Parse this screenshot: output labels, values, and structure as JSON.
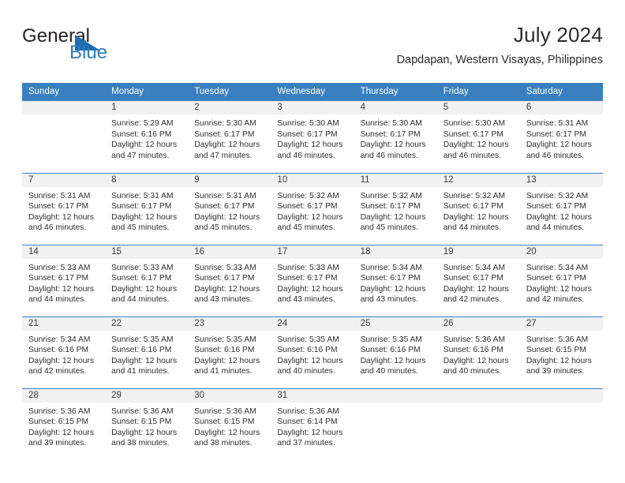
{
  "brand": {
    "word1": "General",
    "word2": "Blue",
    "logo_color": "#2b7cc3"
  },
  "header": {
    "title": "July 2024",
    "subtitle": "Dapdapan, Western Visayas, Philippines"
  },
  "theme": {
    "header_blue": "#3a7fbf",
    "daynum_band": "#f1f1f1"
  },
  "weekday_headers": [
    "Sunday",
    "Monday",
    "Tuesday",
    "Wednesday",
    "Thursday",
    "Friday",
    "Saturday"
  ],
  "weeks": [
    [
      {
        "day": "",
        "blank": true,
        "sunrise": "",
        "sunset": "",
        "daylight1": "",
        "daylight2": ""
      },
      {
        "day": "1",
        "sunrise": "Sunrise: 5:29 AM",
        "sunset": "Sunset: 6:16 PM",
        "daylight1": "Daylight: 12 hours",
        "daylight2": "and 47 minutes."
      },
      {
        "day": "2",
        "sunrise": "Sunrise: 5:30 AM",
        "sunset": "Sunset: 6:17 PM",
        "daylight1": "Daylight: 12 hours",
        "daylight2": "and 47 minutes."
      },
      {
        "day": "3",
        "sunrise": "Sunrise: 5:30 AM",
        "sunset": "Sunset: 6:17 PM",
        "daylight1": "Daylight: 12 hours",
        "daylight2": "and 46 minutes."
      },
      {
        "day": "4",
        "sunrise": "Sunrise: 5:30 AM",
        "sunset": "Sunset: 6:17 PM",
        "daylight1": "Daylight: 12 hours",
        "daylight2": "and 46 minutes."
      },
      {
        "day": "5",
        "sunrise": "Sunrise: 5:30 AM",
        "sunset": "Sunset: 6:17 PM",
        "daylight1": "Daylight: 12 hours",
        "daylight2": "and 46 minutes."
      },
      {
        "day": "6",
        "sunrise": "Sunrise: 5:31 AM",
        "sunset": "Sunset: 6:17 PM",
        "daylight1": "Daylight: 12 hours",
        "daylight2": "and 46 minutes."
      }
    ],
    [
      {
        "day": "7",
        "sunrise": "Sunrise: 5:31 AM",
        "sunset": "Sunset: 6:17 PM",
        "daylight1": "Daylight: 12 hours",
        "daylight2": "and 46 minutes."
      },
      {
        "day": "8",
        "sunrise": "Sunrise: 5:31 AM",
        "sunset": "Sunset: 6:17 PM",
        "daylight1": "Daylight: 12 hours",
        "daylight2": "and 45 minutes."
      },
      {
        "day": "9",
        "sunrise": "Sunrise: 5:31 AM",
        "sunset": "Sunset: 6:17 PM",
        "daylight1": "Daylight: 12 hours",
        "daylight2": "and 45 minutes."
      },
      {
        "day": "10",
        "sunrise": "Sunrise: 5:32 AM",
        "sunset": "Sunset: 6:17 PM",
        "daylight1": "Daylight: 12 hours",
        "daylight2": "and 45 minutes."
      },
      {
        "day": "11",
        "sunrise": "Sunrise: 5:32 AM",
        "sunset": "Sunset: 6:17 PM",
        "daylight1": "Daylight: 12 hours",
        "daylight2": "and 45 minutes."
      },
      {
        "day": "12",
        "sunrise": "Sunrise: 5:32 AM",
        "sunset": "Sunset: 6:17 PM",
        "daylight1": "Daylight: 12 hours",
        "daylight2": "and 44 minutes."
      },
      {
        "day": "13",
        "sunrise": "Sunrise: 5:32 AM",
        "sunset": "Sunset: 6:17 PM",
        "daylight1": "Daylight: 12 hours",
        "daylight2": "and 44 minutes."
      }
    ],
    [
      {
        "day": "14",
        "sunrise": "Sunrise: 5:33 AM",
        "sunset": "Sunset: 6:17 PM",
        "daylight1": "Daylight: 12 hours",
        "daylight2": "and 44 minutes."
      },
      {
        "day": "15",
        "sunrise": "Sunrise: 5:33 AM",
        "sunset": "Sunset: 6:17 PM",
        "daylight1": "Daylight: 12 hours",
        "daylight2": "and 44 minutes."
      },
      {
        "day": "16",
        "sunrise": "Sunrise: 5:33 AM",
        "sunset": "Sunset: 6:17 PM",
        "daylight1": "Daylight: 12 hours",
        "daylight2": "and 43 minutes."
      },
      {
        "day": "17",
        "sunrise": "Sunrise: 5:33 AM",
        "sunset": "Sunset: 6:17 PM",
        "daylight1": "Daylight: 12 hours",
        "daylight2": "and 43 minutes."
      },
      {
        "day": "18",
        "sunrise": "Sunrise: 5:34 AM",
        "sunset": "Sunset: 6:17 PM",
        "daylight1": "Daylight: 12 hours",
        "daylight2": "and 43 minutes."
      },
      {
        "day": "19",
        "sunrise": "Sunrise: 5:34 AM",
        "sunset": "Sunset: 6:17 PM",
        "daylight1": "Daylight: 12 hours",
        "daylight2": "and 42 minutes."
      },
      {
        "day": "20",
        "sunrise": "Sunrise: 5:34 AM",
        "sunset": "Sunset: 6:17 PM",
        "daylight1": "Daylight: 12 hours",
        "daylight2": "and 42 minutes."
      }
    ],
    [
      {
        "day": "21",
        "sunrise": "Sunrise: 5:34 AM",
        "sunset": "Sunset: 6:16 PM",
        "daylight1": "Daylight: 12 hours",
        "daylight2": "and 42 minutes."
      },
      {
        "day": "22",
        "sunrise": "Sunrise: 5:35 AM",
        "sunset": "Sunset: 6:16 PM",
        "daylight1": "Daylight: 12 hours",
        "daylight2": "and 41 minutes."
      },
      {
        "day": "23",
        "sunrise": "Sunrise: 5:35 AM",
        "sunset": "Sunset: 6:16 PM",
        "daylight1": "Daylight: 12 hours",
        "daylight2": "and 41 minutes."
      },
      {
        "day": "24",
        "sunrise": "Sunrise: 5:35 AM",
        "sunset": "Sunset: 6:16 PM",
        "daylight1": "Daylight: 12 hours",
        "daylight2": "and 40 minutes."
      },
      {
        "day": "25",
        "sunrise": "Sunrise: 5:35 AM",
        "sunset": "Sunset: 6:16 PM",
        "daylight1": "Daylight: 12 hours",
        "daylight2": "and 40 minutes."
      },
      {
        "day": "26",
        "sunrise": "Sunrise: 5:36 AM",
        "sunset": "Sunset: 6:16 PM",
        "daylight1": "Daylight: 12 hours",
        "daylight2": "and 40 minutes."
      },
      {
        "day": "27",
        "sunrise": "Sunrise: 5:36 AM",
        "sunset": "Sunset: 6:15 PM",
        "daylight1": "Daylight: 12 hours",
        "daylight2": "and 39 minutes."
      }
    ],
    [
      {
        "day": "28",
        "sunrise": "Sunrise: 5:36 AM",
        "sunset": "Sunset: 6:15 PM",
        "daylight1": "Daylight: 12 hours",
        "daylight2": "and 39 minutes."
      },
      {
        "day": "29",
        "sunrise": "Sunrise: 5:36 AM",
        "sunset": "Sunset: 6:15 PM",
        "daylight1": "Daylight: 12 hours",
        "daylight2": "and 38 minutes."
      },
      {
        "day": "30",
        "sunrise": "Sunrise: 5:36 AM",
        "sunset": "Sunset: 6:15 PM",
        "daylight1": "Daylight: 12 hours",
        "daylight2": "and 38 minutes."
      },
      {
        "day": "31",
        "sunrise": "Sunrise: 5:36 AM",
        "sunset": "Sunset: 6:14 PM",
        "daylight1": "Daylight: 12 hours",
        "daylight2": "and 37 minutes."
      },
      {
        "day": "",
        "blank": true,
        "sunrise": "",
        "sunset": "",
        "daylight1": "",
        "daylight2": ""
      },
      {
        "day": "",
        "blank": true,
        "sunrise": "",
        "sunset": "",
        "daylight1": "",
        "daylight2": ""
      },
      {
        "day": "",
        "blank": true,
        "sunrise": "",
        "sunset": "",
        "daylight1": "",
        "daylight2": ""
      }
    ]
  ]
}
